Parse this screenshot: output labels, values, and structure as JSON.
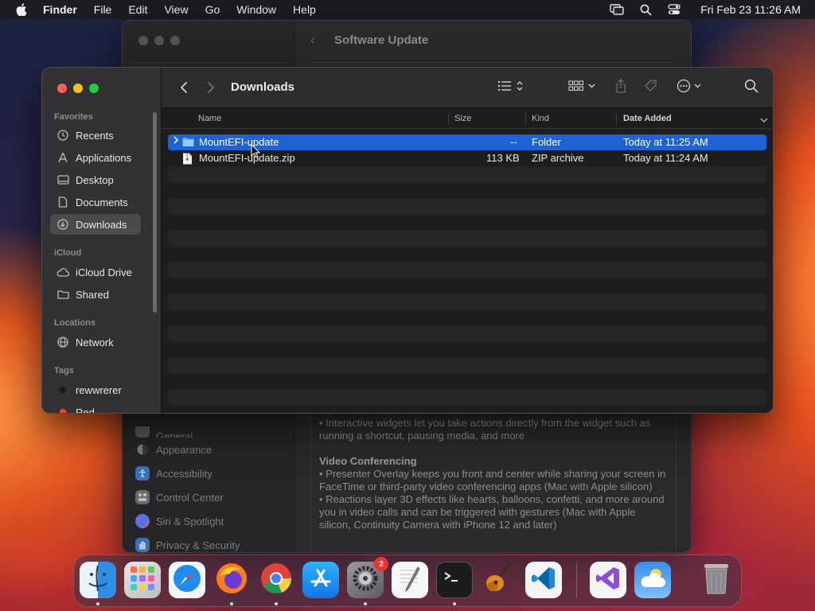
{
  "menubar": {
    "app_name": "Finder",
    "items": [
      "File",
      "Edit",
      "View",
      "Go",
      "Window",
      "Help"
    ],
    "clock": "Fri Feb 23  11:26 AM",
    "icons": [
      "display-mirroring-icon",
      "spotlight-search-icon",
      "control-center-icon"
    ]
  },
  "settings_window": {
    "title": "Software Update",
    "sidebar_items": [
      {
        "label": "General",
        "color": "#8e8e93"
      },
      {
        "label": "Appearance",
        "color": "#3a3a3c"
      },
      {
        "label": "Accessibility",
        "color": "#1f6fe0"
      },
      {
        "label": "Control Center",
        "color": "#8e8e93"
      },
      {
        "label": "Siri & Spotlight",
        "color": "#b04fd8"
      },
      {
        "label": "Privacy & Security",
        "color": "#3b7be8"
      }
    ],
    "notes": {
      "line1": "• Interactive widgets let you take actions directly from the widget such as running a shortcut, pausing media, and more",
      "heading": "Video Conferencing",
      "line2": "• Presenter Overlay keeps you front and center while sharing your screen in FaceTime or third-party video conferencing apps (Mac with Apple silicon)",
      "line3": "• Reactions layer 3D effects like hearts, balloons, confetti, and more around you in video calls and can be triggered with gestures (Mac with Apple silicon, Continuity Camera with iPhone 12 and later)"
    }
  },
  "finder": {
    "title": "Downloads",
    "sidebar": {
      "favorites_label": "Favorites",
      "favorites": [
        "Recents",
        "Applications",
        "Desktop",
        "Documents",
        "Downloads"
      ],
      "icloud_label": "iCloud",
      "icloud": [
        "iCloud Drive",
        "Shared"
      ],
      "locations_label": "Locations",
      "locations": [
        "Network"
      ],
      "tags_label": "Tags",
      "tags": [
        {
          "label": "rewwrerer",
          "color": "#1a1a1a"
        },
        {
          "label": "Red",
          "color": "#ff3b30"
        }
      ]
    },
    "columns": {
      "name": "Name",
      "size": "Size",
      "kind": "Kind",
      "date_added": "Date Added"
    },
    "files": [
      {
        "name": "MountEFI-update",
        "size": "--",
        "kind": "Folder",
        "date_added": "Today at 11:25 AM",
        "selected": true
      },
      {
        "name": "MountEFI-update.zip",
        "size": "113 KB",
        "kind": "ZIP archive",
        "date_added": "Today at 11:24 AM",
        "selected": false
      }
    ]
  },
  "dock": {
    "apps": [
      {
        "name": "Finder",
        "running": true
      },
      {
        "name": "Launchpad",
        "running": false
      },
      {
        "name": "Safari",
        "running": false
      },
      {
        "name": "Firefox",
        "running": true
      },
      {
        "name": "Google Chrome",
        "running": true
      },
      {
        "name": "App Store",
        "running": false
      },
      {
        "name": "System Settings",
        "running": true,
        "badge": "2"
      },
      {
        "name": "TextEdit",
        "running": false
      },
      {
        "name": "Terminal",
        "running": true
      },
      {
        "name": "GarageBand",
        "running": false
      },
      {
        "name": "Visual Studio Code",
        "running": false
      },
      {
        "name": "Visual Studio",
        "running": false
      },
      {
        "name": "Weather",
        "running": false
      },
      {
        "name": "Trash",
        "running": false
      }
    ]
  }
}
